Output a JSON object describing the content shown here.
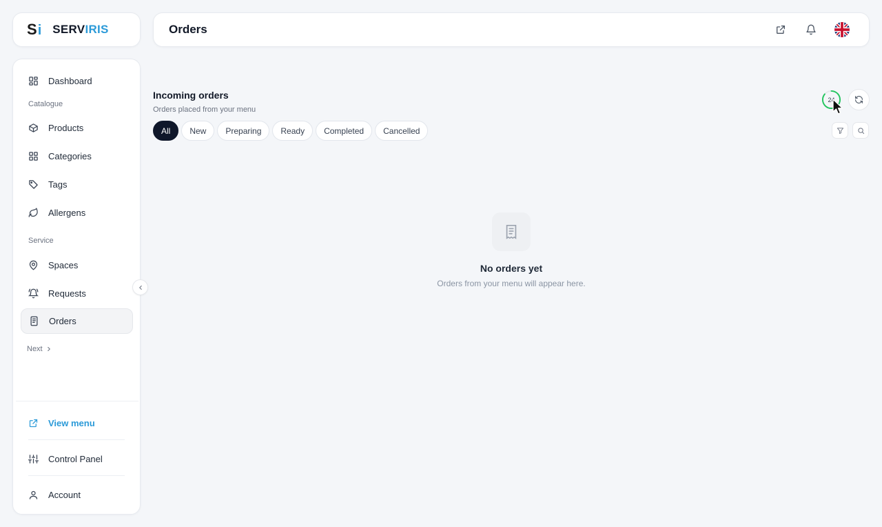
{
  "brand": {
    "mark_letter": "S",
    "mark_accent": "i",
    "name_part1": "SERV",
    "name_part2": "IRIS",
    "accent_color": "#2b9ad8"
  },
  "header": {
    "title": "Orders",
    "icons": [
      "external-link-icon",
      "bell-icon",
      "uk-flag-icon"
    ]
  },
  "sidebar": {
    "dashboard": "Dashboard",
    "catalogue_label": "Catalogue",
    "products": "Products",
    "categories": "Categories",
    "tags": "Tags",
    "allergens": "Allergens",
    "service_label": "Service",
    "spaces": "Spaces",
    "requests": "Requests",
    "orders": "Orders",
    "next": "Next",
    "view_menu": "View menu",
    "control_panel": "Control Panel",
    "account": "Account",
    "active_item": "Orders"
  },
  "main": {
    "section_title": "Incoming orders",
    "section_subtitle": "Orders placed from your menu",
    "refresh_countdown": "24",
    "filters": [
      "All",
      "New",
      "Preparing",
      "Ready",
      "Completed",
      "Cancelled"
    ],
    "active_filter": "All",
    "empty_title": "No orders yet",
    "empty_subtitle": "Orders from your menu will appear here."
  },
  "colors": {
    "active_chip": "#0f172a",
    "countdown_ring": "#22c55e",
    "background": "#f4f6f9"
  }
}
